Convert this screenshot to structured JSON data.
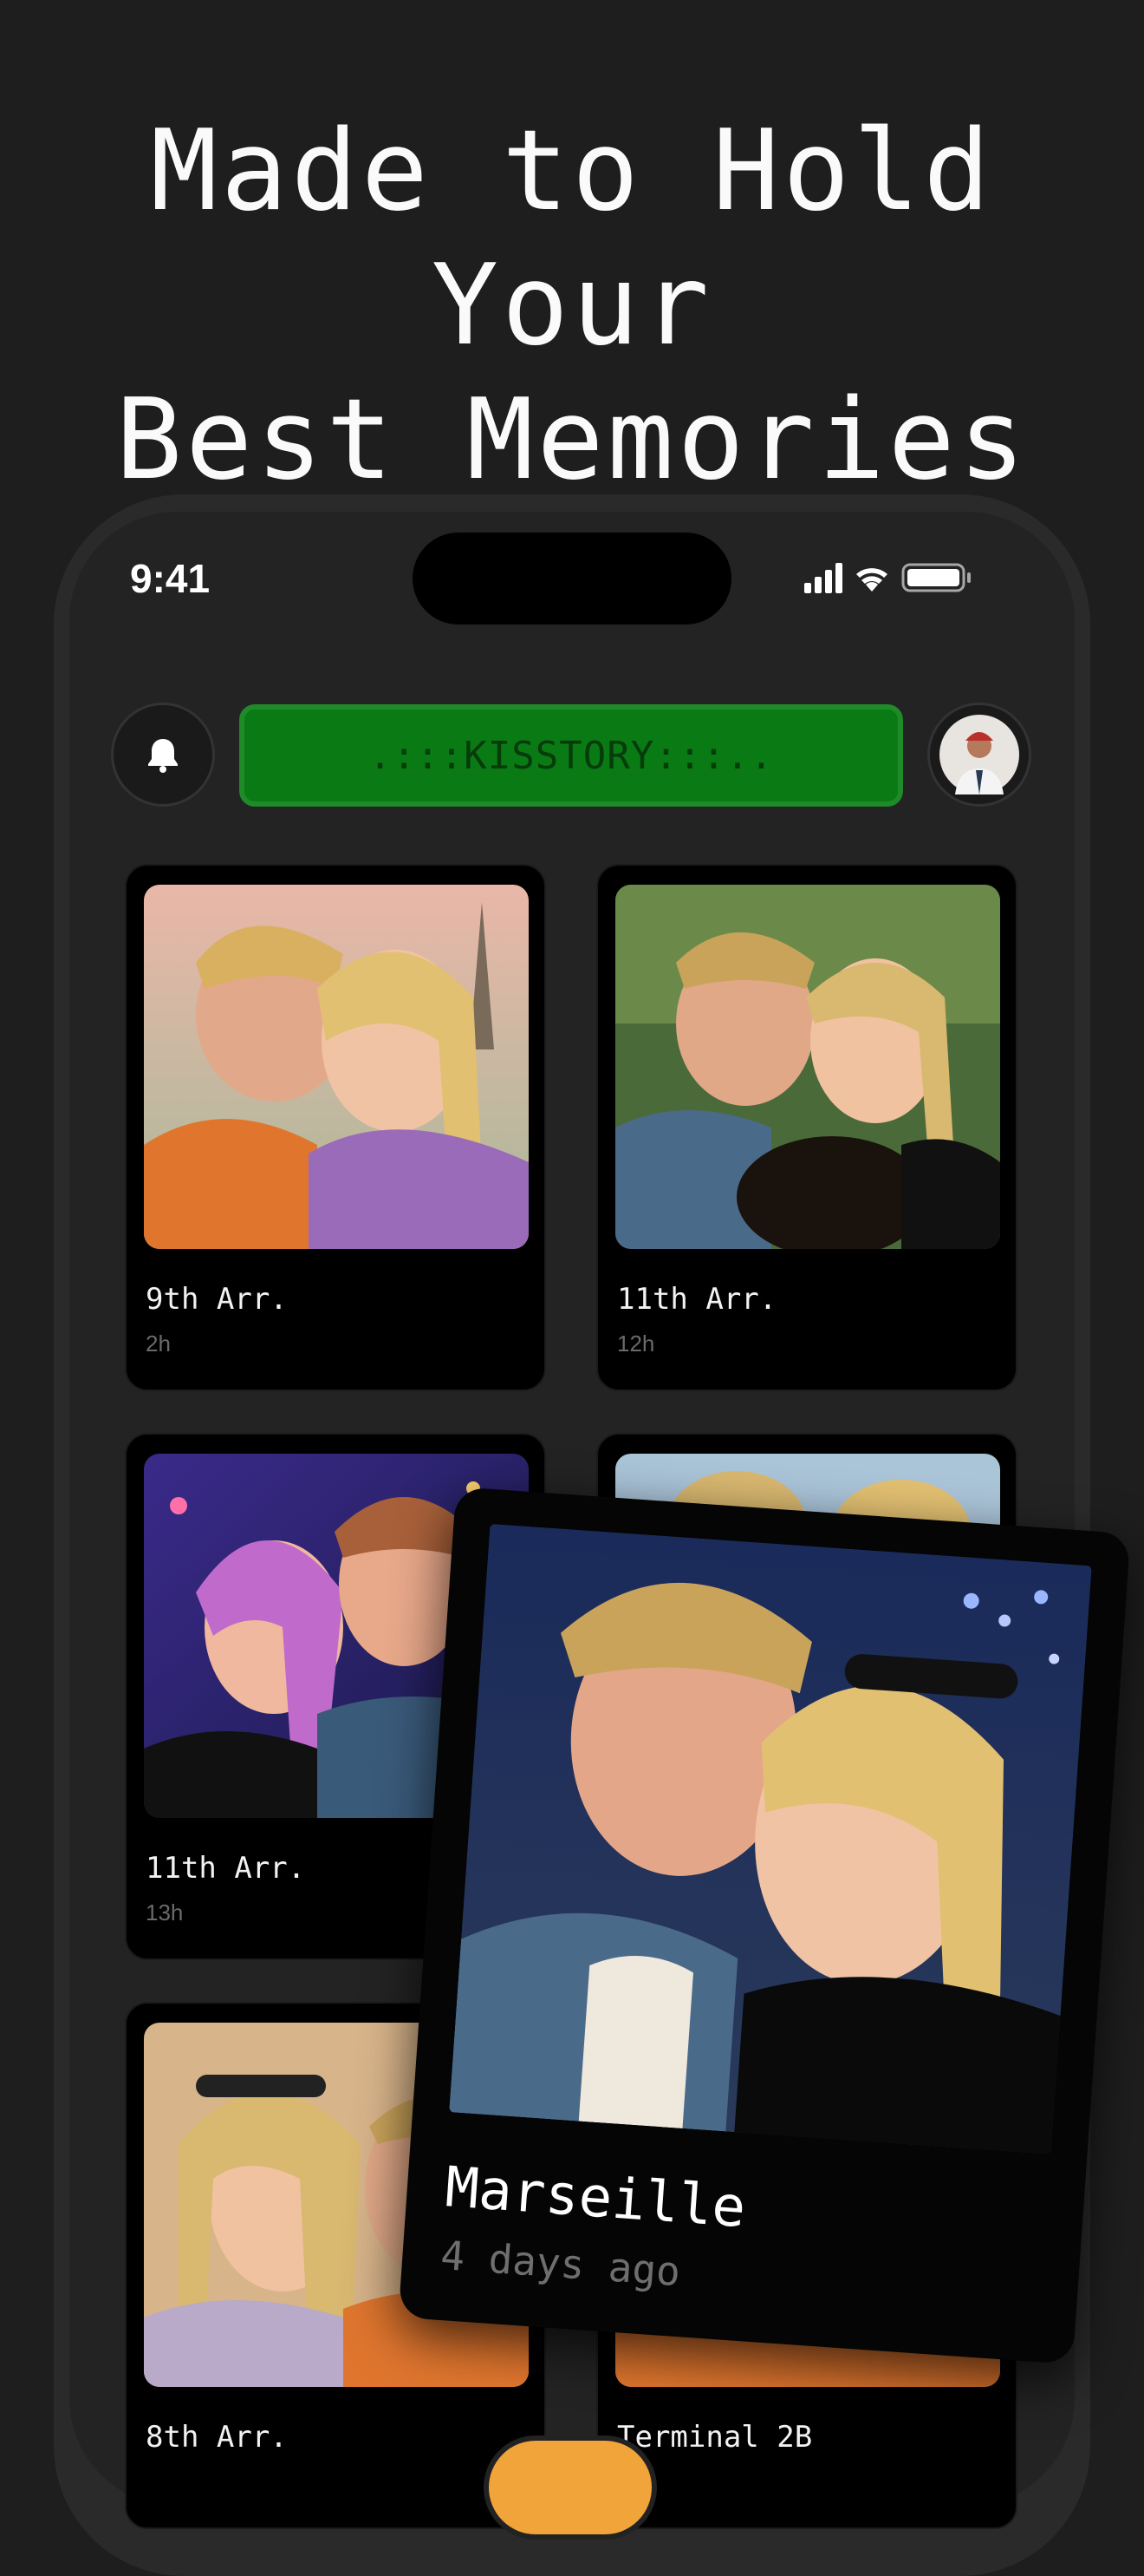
{
  "headline": {
    "line1": "Made to Hold Your",
    "line2": "Best Memories"
  },
  "status_bar": {
    "time": "9:41",
    "icons": [
      "signal-icon",
      "wifi-icon",
      "battery-icon"
    ]
  },
  "header": {
    "bell_icon": "bell-icon",
    "banner_text": ".:::KISSTORY:::..",
    "banner_color": "#0a7a15",
    "avatar": "profile-avatar"
  },
  "cards": [
    {
      "title": "9th Arr.",
      "time": "2h"
    },
    {
      "title": "11th Arr.",
      "time": "12h"
    },
    {
      "title": "11th Arr.",
      "time": "13h"
    },
    {
      "title": "",
      "time": ""
    },
    {
      "title": "8th Arr.",
      "time": ""
    },
    {
      "title": "Terminal 2B",
      "time": ""
    }
  ],
  "featured_card": {
    "title": "Marseille",
    "time": "4 days ago"
  },
  "colors": {
    "background": "#1e1e1e",
    "accent_green": "#0a7a15",
    "accent_orange": "#f0a43a"
  }
}
